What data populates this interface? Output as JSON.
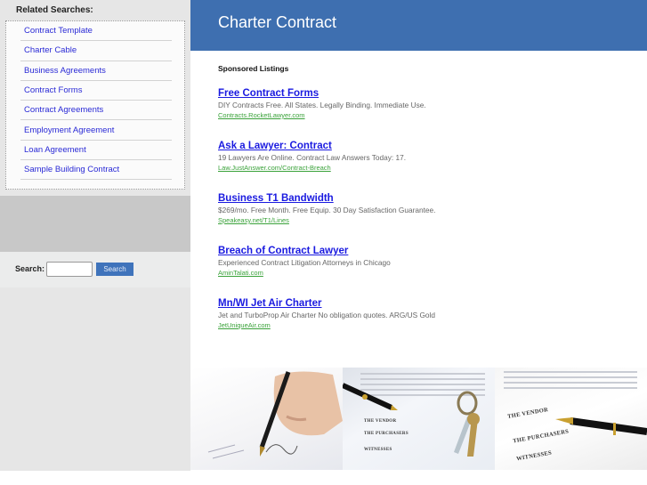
{
  "sidebar": {
    "related_title": "Related Searches:",
    "related_items": [
      {
        "label": "Contract Template"
      },
      {
        "label": "Charter Cable"
      },
      {
        "label": "Business Agreements"
      },
      {
        "label": "Contract Forms"
      },
      {
        "label": "Contract Agreements"
      },
      {
        "label": "Employment Agreement"
      },
      {
        "label": "Loan Agreement"
      },
      {
        "label": "Sample Building Contract"
      }
    ],
    "search": {
      "label": "Search:",
      "value": "",
      "placeholder": "",
      "button_label": "Search"
    }
  },
  "header": {
    "title": "Charter Contract",
    "color": "#3e6fb0"
  },
  "content": {
    "sponsored_label": "Sponsored Listings",
    "listings": [
      {
        "title": "Free Contract Forms",
        "description": "DIY Contracts Free. All States. Legally Binding. Immediate Use.",
        "url": "Contracts.RocketLawyer.com"
      },
      {
        "title": "Ask a Lawyer: Contract",
        "description": "19 Lawyers Are Online. Contract Law Answers Today: 17.",
        "url": "Law.JustAnswer.com/Contract-Breach"
      },
      {
        "title": "Business T1 Bandwidth",
        "description": "$269/mo. Free Month. Free Equip. 30 Day Satisfaction Guarantee.",
        "url": "Speakeasy.net/T1/Lines"
      },
      {
        "title": "Breach of Contract Lawyer",
        "description": "Experienced Contract Litigation Attorneys in Chicago",
        "url": "AminTalati.com"
      },
      {
        "title": "Mn/WI Jet Air Charter",
        "description": "Jet and TurboProp Air Charter No obligation quotes. ARG/US Gold",
        "url": "JetUniqueAir.com"
      }
    ]
  },
  "photos": {
    "labels": {
      "vendor": "THE VENDOR",
      "purchasers": "THE PURCHASERS",
      "witnesses": "WITNESSES"
    }
  },
  "colors": {
    "link": "#1a1ae0",
    "url": "#3aa23a",
    "sidebar_link": "#2a2ad6",
    "button": "#3f73bb"
  }
}
